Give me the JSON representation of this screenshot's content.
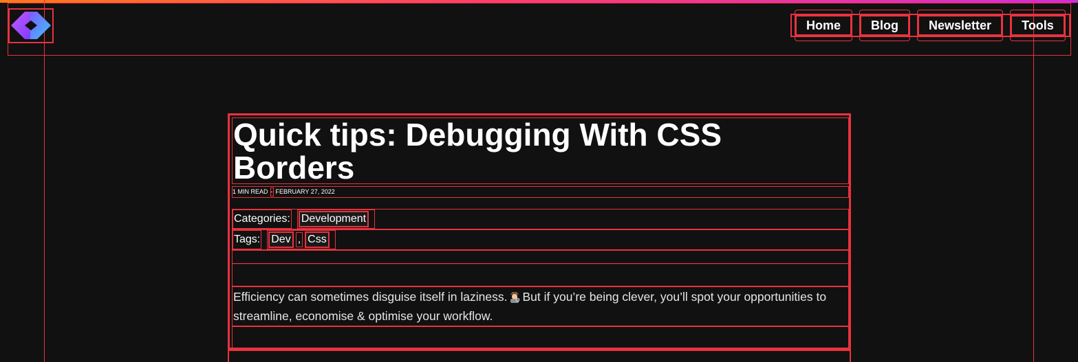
{
  "nav": {
    "items": [
      {
        "label": "Home"
      },
      {
        "label": "Blog"
      },
      {
        "label": "Newsletter"
      },
      {
        "label": "Tools"
      }
    ]
  },
  "article": {
    "title": "Quick tips: Debugging With CSS Borders",
    "read_time": "1 MIN READ",
    "separator": "-",
    "date": "FEBRUARY 27, 2022",
    "categories_label": "Categories:",
    "categories": [
      "Development"
    ],
    "tags_label": "Tags:",
    "tags": [
      "Dev",
      "Css"
    ],
    "tag_separator": ",",
    "body_before_emoji": "Efficiency can sometimes disguise itself in laziness.",
    "body_after_emoji": "But if you’re being clever, you’ll spot your opportunities to streamline, economise & optimise your workflow.",
    "emoji_icon": "detective-emoji-icon"
  },
  "colors": {
    "background": "#111111",
    "debug_border": "#e8333f",
    "gradient_start": "#ff7a18",
    "gradient_end": "#d42bd9",
    "logo_left": "#b34dff",
    "logo_right": "#3fb6ff"
  }
}
